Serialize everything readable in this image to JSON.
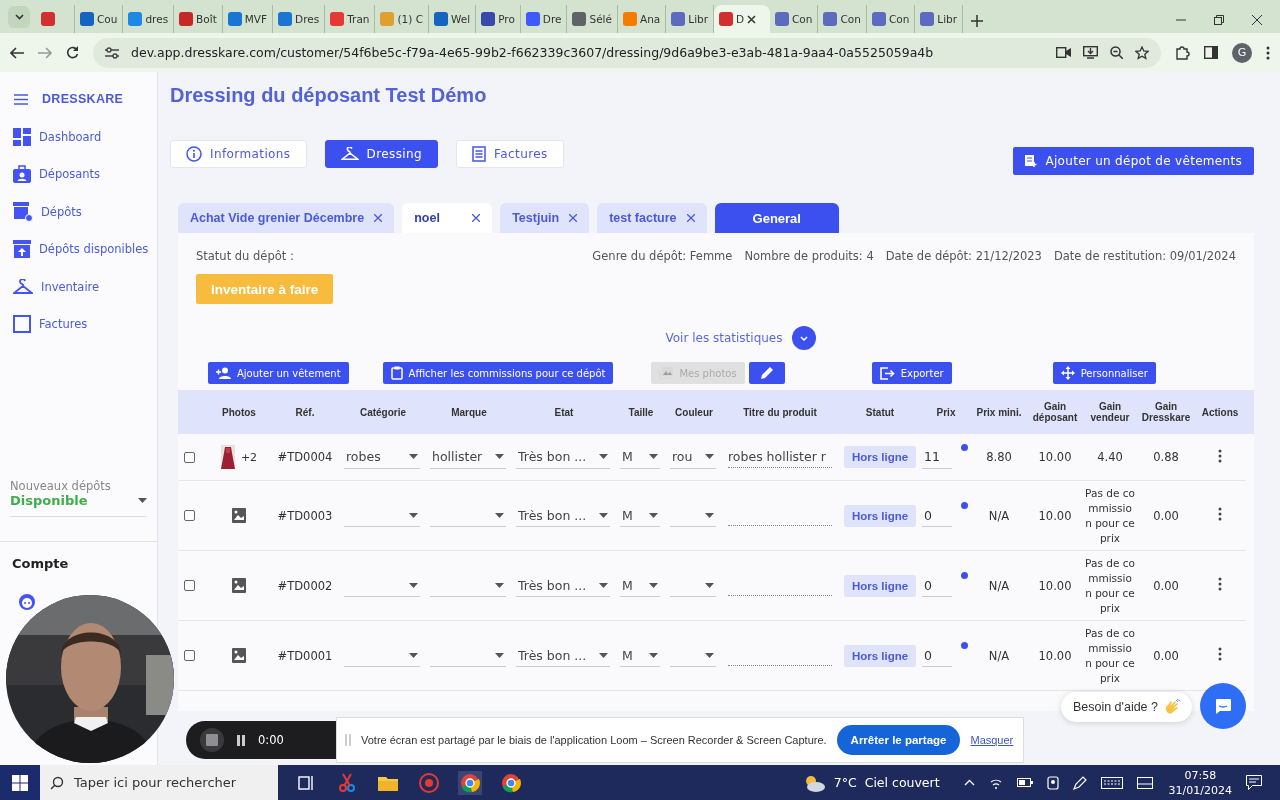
{
  "browser": {
    "tabs": [
      {
        "selected": false,
        "color": "#d32f2f"
      },
      {
        "label": "Cou",
        "selected": false,
        "color": "#1565c0"
      },
      {
        "label": "dres",
        "selected": false,
        "color": "#1e88e5"
      },
      {
        "label": "Boît",
        "selected": false,
        "color": "#c62828"
      },
      {
        "label": "MVF",
        "selected": false,
        "color": "#1976d2"
      },
      {
        "label": "Dres",
        "selected": false,
        "color": "#1976d2"
      },
      {
        "label": "Tran",
        "selected": false,
        "color": "#e53935"
      },
      {
        "label": "(1) C",
        "selected": false,
        "color": "#e0a030"
      },
      {
        "label": "Wel",
        "selected": false,
        "color": "#1565c0"
      },
      {
        "label": "Pro",
        "selected": false,
        "color": "#3949ab"
      },
      {
        "label": "Dre",
        "selected": false,
        "color": "#3d5afe"
      },
      {
        "label": "Sélé",
        "selected": false,
        "color": "#5f6368"
      },
      {
        "label": "Ana",
        "selected": false,
        "color": "#f57c00"
      },
      {
        "label": "Libr",
        "selected": false,
        "color": "#5c6bc0"
      },
      {
        "label": "D",
        "selected": true,
        "color": "#d32f2f"
      },
      {
        "label": "Con",
        "selected": false,
        "color": "#5c6bc0"
      },
      {
        "label": "Con",
        "selected": false,
        "color": "#5c6bc0"
      },
      {
        "label": "Con",
        "selected": false,
        "color": "#5c6bc0"
      },
      {
        "label": "Libr",
        "selected": false,
        "color": "#5c6bc0"
      }
    ],
    "url": "dev.app.dresskare.com/customer/54f6be5c-f79a-4e65-99b2-f662339c3607/dressing/9d6a9be3-e3ab-481a-9aa4-0a5525059a4b",
    "profile": "G"
  },
  "sidebar": {
    "brand": "DRESSKARE",
    "items": [
      {
        "label": "Dashboard"
      },
      {
        "label": "Déposants"
      },
      {
        "label": "Dépôts"
      },
      {
        "label": "Dépôts disponibles"
      },
      {
        "label": "Inventaire"
      },
      {
        "label": "Factures"
      }
    ],
    "new_deposits": {
      "label": "Nouveaux dépôts",
      "value": "Disponible"
    },
    "account_title": "Compte"
  },
  "page": {
    "title": "Dressing du déposant Test Démo",
    "view_tabs": [
      {
        "label": "Informations",
        "selected": false
      },
      {
        "label": "Dressing",
        "selected": true
      },
      {
        "label": "Factures",
        "selected": false
      }
    ],
    "add_button": "Ajouter un dépot de vêtements"
  },
  "deposit_tabs": [
    {
      "label": "Achat Vide grenier Décembre",
      "selected": false
    },
    {
      "label": "noel",
      "selected": true
    },
    {
      "label": "Testjuin",
      "selected": false
    },
    {
      "label": "test facture",
      "selected": false
    }
  ],
  "general_button": "General",
  "deposit": {
    "status_label": "Statut du dépôt :",
    "status": "Inventaire à faire",
    "info": [
      "Genre du dépôt: Femme",
      "Nombre de produits: 4",
      "Date de dépôt: 21/12/2023",
      "Date de restitution: 09/01/2024"
    ],
    "stats_link": "Voir les statistiques"
  },
  "toolbar": [
    {
      "kind": "button",
      "label": "Ajouter un vêtement",
      "disabled": false
    },
    {
      "kind": "button",
      "label": "Afficher les commissions pour ce dépôt",
      "disabled": false
    },
    {
      "kind": "button",
      "label": "Mes photos",
      "disabled": true
    },
    {
      "kind": "icon",
      "disabled": false
    },
    {
      "kind": "button",
      "label": "Exporter",
      "disabled": false
    },
    {
      "kind": "button",
      "label": "Personnaliser",
      "disabled": false
    }
  ],
  "table": {
    "columns": [
      "Photos",
      "Réf.",
      "Catégorie",
      "Marque",
      "Etat",
      "Taille",
      "Couleur",
      "Titre du produit",
      "Statut",
      "Prix",
      "Prix mini.",
      "Gain déposant",
      "Gain vendeur",
      "Gain Dresskare",
      "Actions"
    ],
    "rows": [
      {
        "checked": false,
        "kind": "thumbnail",
        "photo_count": "+2",
        "ref": "#TD0004",
        "category": "robes",
        "brand": "hollister",
        "condition": "Très bon ...",
        "size": "M",
        "colour": "rou",
        "title": "robes hollister r",
        "status": "Hors ligne",
        "price": "11",
        "price_min": "8.80",
        "gain_depositor": "10.00",
        "gain_seller": "4.40",
        "gain_dresskare": "0.88"
      },
      {
        "checked": false,
        "kind": "placeholder",
        "ref": "#TD0003",
        "condition": "Très bon ...",
        "size": "M",
        "status": "Hors ligne",
        "price": "0",
        "price_min": "N/A",
        "gain_depositor": "10.00",
        "gain_seller": "Pas de commission pour ce prix",
        "gain_dresskare": "0.00"
      },
      {
        "checked": false,
        "kind": "placeholder",
        "ref": "#TD0002",
        "condition": "Très bon ...",
        "size": "M",
        "status": "Hors ligne",
        "price": "0",
        "price_min": "N/A",
        "gain_depositor": "10.00",
        "gain_seller": "Pas de commission pour ce prix",
        "gain_dresskare": "0.00"
      },
      {
        "checked": false,
        "kind": "placeholder",
        "ref": "#TD0001",
        "condition": "Très bon ...",
        "size": "M",
        "status": "Hors ligne",
        "price": "0",
        "price_min": "N/A",
        "gain_depositor": "10.00",
        "gain_seller": "Pas de commission pour ce prix",
        "gain_dresskare": "0.00"
      }
    ]
  },
  "help": "Besoin d'aide ?",
  "loom": {
    "timer": "0:00",
    "message": "Votre écran est partagé par le biais de l'application Loom – Screen Recorder & Screen Capture.",
    "stop": "Arrêter le partage",
    "hide": "Masquer"
  },
  "taskbar": {
    "search_placeholder": "Taper ici pour rechercher",
    "temperature": "7°C",
    "weather": "Ciel couvert",
    "time": "07:58",
    "date": "31/01/2024"
  }
}
